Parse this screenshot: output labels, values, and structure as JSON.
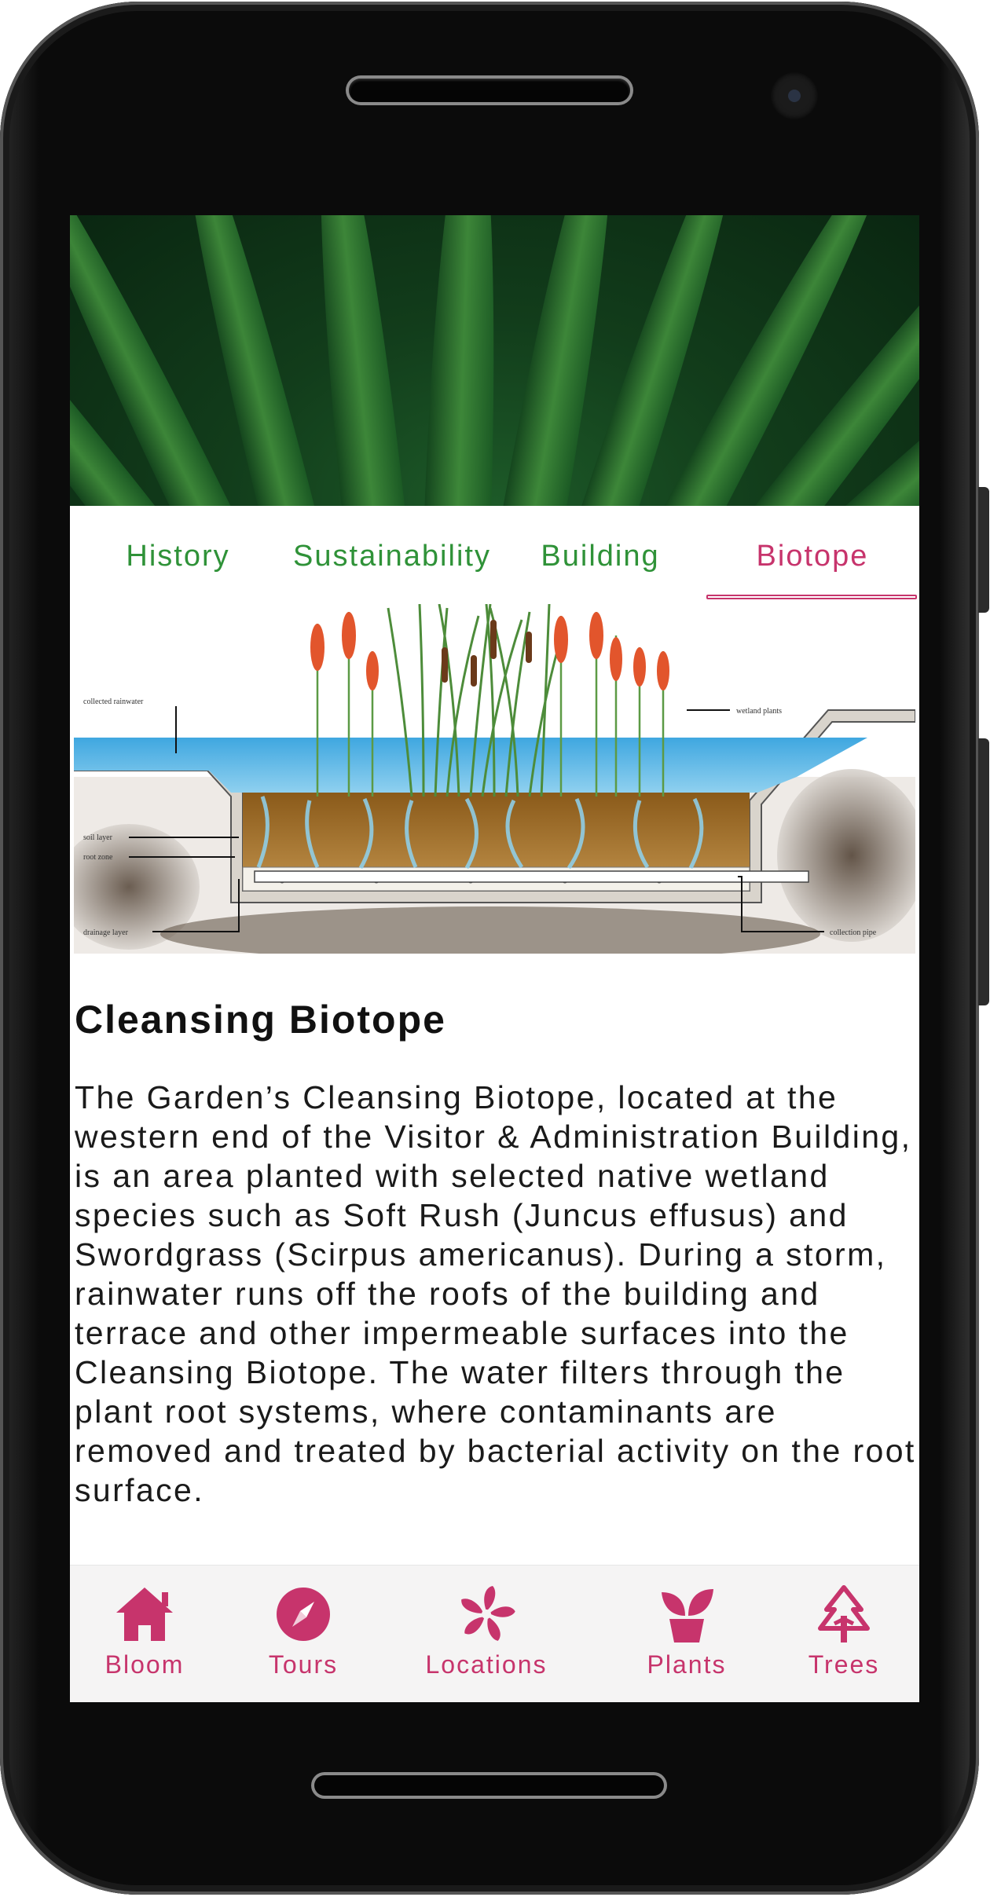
{
  "tabs": [
    {
      "label": "History",
      "active": false
    },
    {
      "label": "Sustainability",
      "active": false
    },
    {
      "label": "Building",
      "active": false
    },
    {
      "label": "Biotope",
      "active": true
    }
  ],
  "diagram": {
    "labels": {
      "collected_rainwater": "collected rainwater",
      "wetland_plants": "wetland plants",
      "soil_layer": "soil layer",
      "root_zone": "root zone",
      "drainage_layer": "drainage layer",
      "collection_pipe": "collection pipe"
    }
  },
  "article": {
    "title": "Cleansing Biotope",
    "body": "The Garden’s Cleansing Biotope, located at the western end of the Visitor & Administration Building, is an area planted with selected native wetland species such as Soft Rush (Juncus effusus) and Swordgrass (Scirpus americanus). During a storm, rainwater runs off the roofs of the building and terrace and other impermeable surfaces into the Cleansing Biotope. The water filters through the plant root systems, where contaminants are removed and treated by bacterial activity on the root surface."
  },
  "nav": [
    {
      "label": "Bloom",
      "icon": "home-icon"
    },
    {
      "label": "Tours",
      "icon": "compass-icon"
    },
    {
      "label": "Locations",
      "icon": "pinwheel-icon"
    },
    {
      "label": "Plants",
      "icon": "potted-plant-icon"
    },
    {
      "label": "Trees",
      "icon": "pine-tree-icon"
    }
  ],
  "colors": {
    "accent": "#c7346c",
    "tab_text": "#2f9238",
    "hero_green": "#1d5a28"
  }
}
